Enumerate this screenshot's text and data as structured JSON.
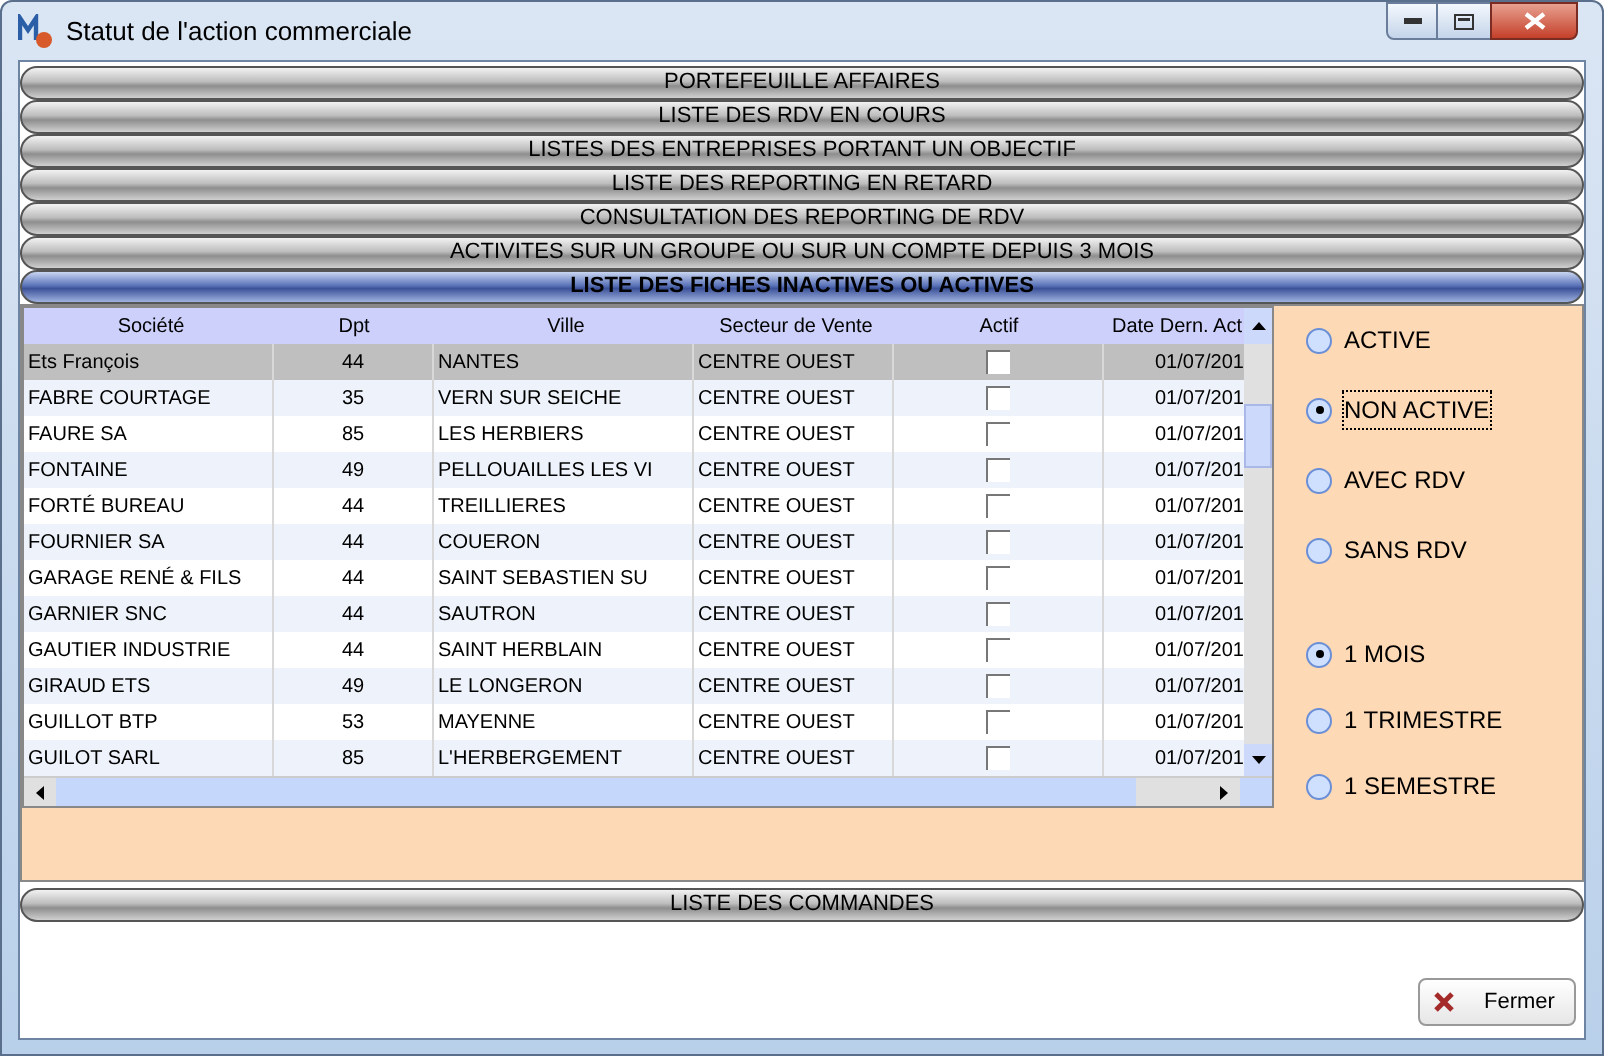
{
  "window": {
    "title": "Statut de l'action commerciale"
  },
  "sections": [
    {
      "label": "PORTEFEUILLE AFFAIRES",
      "expanded": false
    },
    {
      "label": "LISTE DES RDV EN COURS",
      "expanded": false
    },
    {
      "label": "LISTES DES ENTREPRISES PORTANT UN OBJECTIF",
      "expanded": false
    },
    {
      "label": "LISTE DES REPORTING EN RETARD",
      "expanded": false
    },
    {
      "label": "CONSULTATION DES REPORTING DE RDV",
      "expanded": false
    },
    {
      "label": "ACTIVITES SUR UN GROUPE OU SUR UN COMPTE DEPUIS 3 MOIS",
      "expanded": false
    },
    {
      "label": "LISTE DES FICHES INACTIVES OU ACTIVES",
      "expanded": true
    },
    {
      "label": "LISTE DES COMMANDES",
      "expanded": false
    }
  ],
  "table": {
    "columns": [
      "Société",
      "Dpt",
      "Ville",
      "Secteur de Vente",
      "Actif",
      "Date Dern. Act"
    ],
    "rows": [
      {
        "cells": [
          "Ets François",
          "44",
          "NANTES",
          "CENTRE OUEST",
          "01/07/201"
        ],
        "actif": false,
        "selected": true
      },
      {
        "cells": [
          "FABRE COURTAGE",
          "35",
          "VERN SUR SEICHE",
          "CENTRE OUEST",
          "01/07/201"
        ],
        "actif": false,
        "selected": false
      },
      {
        "cells": [
          "FAURE SA",
          "85",
          "LES HERBIERS",
          "CENTRE OUEST",
          "01/07/201"
        ],
        "actif": false,
        "selected": false
      },
      {
        "cells": [
          "FONTAINE",
          "49",
          "PELLOUAILLES LES VI",
          "CENTRE OUEST",
          "01/07/201"
        ],
        "actif": false,
        "selected": false
      },
      {
        "cells": [
          "FORTÉ BUREAU",
          "44",
          "TREILLIERES",
          "CENTRE OUEST",
          "01/07/201"
        ],
        "actif": false,
        "selected": false
      },
      {
        "cells": [
          "FOURNIER SA",
          "44",
          "COUERON",
          "CENTRE OUEST",
          "01/07/201"
        ],
        "actif": false,
        "selected": false
      },
      {
        "cells": [
          "GARAGE RENÉ & FILS",
          "44",
          "SAINT SEBASTIEN SU",
          "CENTRE OUEST",
          "01/07/201"
        ],
        "actif": false,
        "selected": false
      },
      {
        "cells": [
          "GARNIER SNC",
          "44",
          "SAUTRON",
          "CENTRE OUEST",
          "01/07/201"
        ],
        "actif": false,
        "selected": false
      },
      {
        "cells": [
          "GAUTIER INDUSTRIE",
          "44",
          "SAINT HERBLAIN",
          "CENTRE OUEST",
          "01/07/201"
        ],
        "actif": false,
        "selected": false
      },
      {
        "cells": [
          "GIRAUD ETS",
          "49",
          "LE LONGERON",
          "CENTRE OUEST",
          "01/07/201"
        ],
        "actif": false,
        "selected": false
      },
      {
        "cells": [
          "GUILLOT BTP",
          "53",
          "MAYENNE",
          "CENTRE OUEST",
          "01/07/201"
        ],
        "actif": false,
        "selected": false
      },
      {
        "cells": [
          "GUILOT SARL",
          "85",
          "L'HERBERGEMENT",
          "CENTRE OUEST",
          "01/07/201"
        ],
        "actif": false,
        "selected": false
      }
    ]
  },
  "filters": [
    {
      "label": "ACTIVE",
      "selected": false
    },
    {
      "label": "NON ACTIVE",
      "selected": true
    },
    {
      "label": "AVEC RDV",
      "selected": false
    },
    {
      "label": "SANS RDV",
      "selected": false
    }
  ],
  "periods": [
    {
      "label": "1 MOIS",
      "selected": true
    },
    {
      "label": "1 TRIMESTRE",
      "selected": false
    },
    {
      "label": "1 SEMESTRE",
      "selected": false
    }
  ],
  "close_button": "Fermer"
}
